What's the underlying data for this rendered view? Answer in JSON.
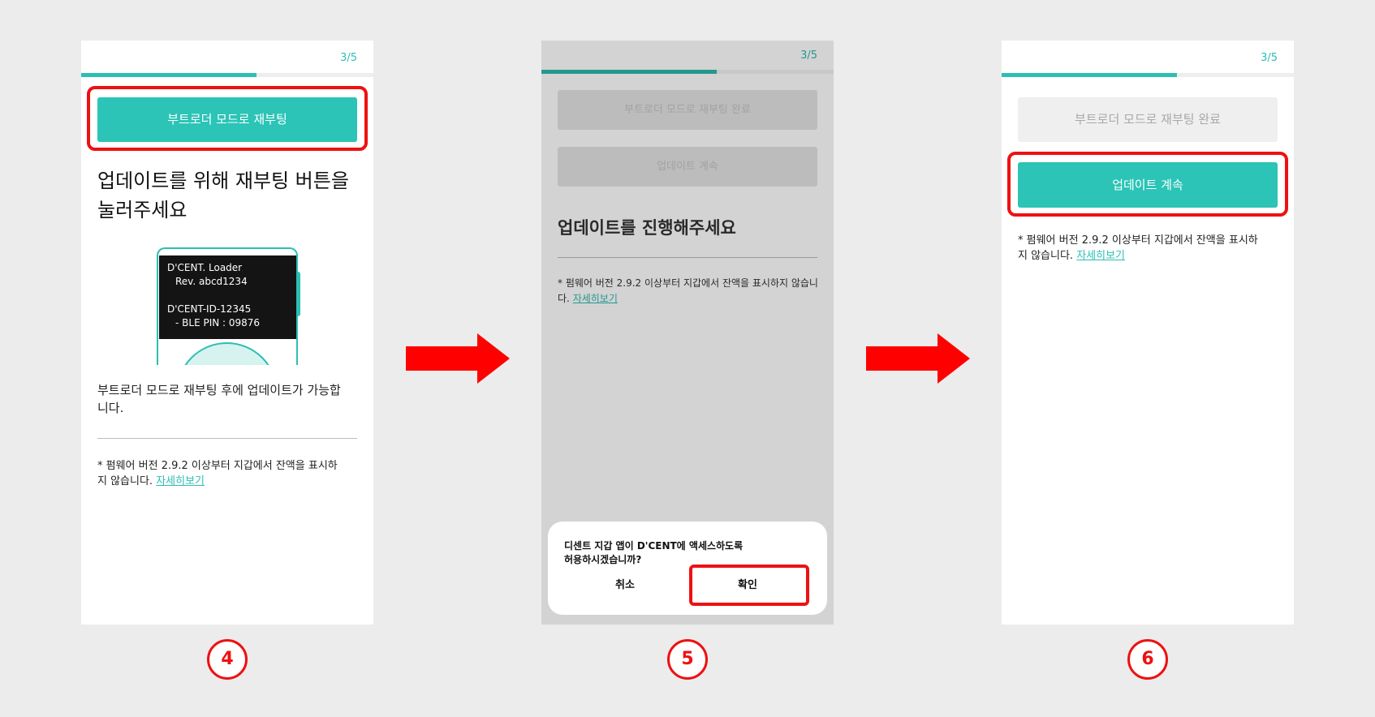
{
  "screens": [
    {
      "step_count": "3/5",
      "progress": 0.6,
      "reboot_button": "부트로더 모드로 재부팅",
      "heading_line1": "업데이트를 위해 재부팅 버튼을",
      "heading_line2": "눌러주세요",
      "device": {
        "line1": "D'CENT. Loader",
        "line2": "Rev. abcd1234",
        "line3": "D'CENT-ID-12345",
        "line4": "- BLE PIN : 09876"
      },
      "body_line1": "부트로더 모드로 재부팅 후에 업데이트가 가능합",
      "body_line2": "니다.",
      "note_line1": "* 펌웨어 버전 2.9.2 이상부터 지갑에서 잔액을 표시하",
      "note_line2": "지 않습니다.",
      "note_link": "자세히보기"
    },
    {
      "step_count": "3/5",
      "progress": 0.6,
      "reboot_done_button": "부트로더 모드로 재부팅 완료",
      "continue_button": "업데이트 계속",
      "heading": "업데이트를 진행해주세요",
      "note_line1": "* 펌웨어 버전 2.9.2 이상부터 지갑에서 잔액을 표시하지 않습니",
      "note_line2": "다.",
      "note_link": "자세히보기",
      "dialog": {
        "line1": "디센트 지갑 앱이 D'CENT에 액세스하도록",
        "line2": "허용하시겠습니까?",
        "cancel": "취소",
        "confirm": "확인"
      }
    },
    {
      "step_count": "3/5",
      "progress": 0.6,
      "reboot_done_button": "부트로더 모드로 재부팅 완료",
      "continue_button": "업데이트 계속",
      "note_line1": "* 펌웨어 버전 2.9.2 이상부터 지갑에서 잔액을 표시하",
      "note_line2": "지 않습니다.",
      "note_link": "자세히보기"
    }
  ],
  "step_badges": [
    "4",
    "5",
    "6"
  ],
  "colors": {
    "accent": "#2bc4b6",
    "highlight": "#ee1111"
  }
}
